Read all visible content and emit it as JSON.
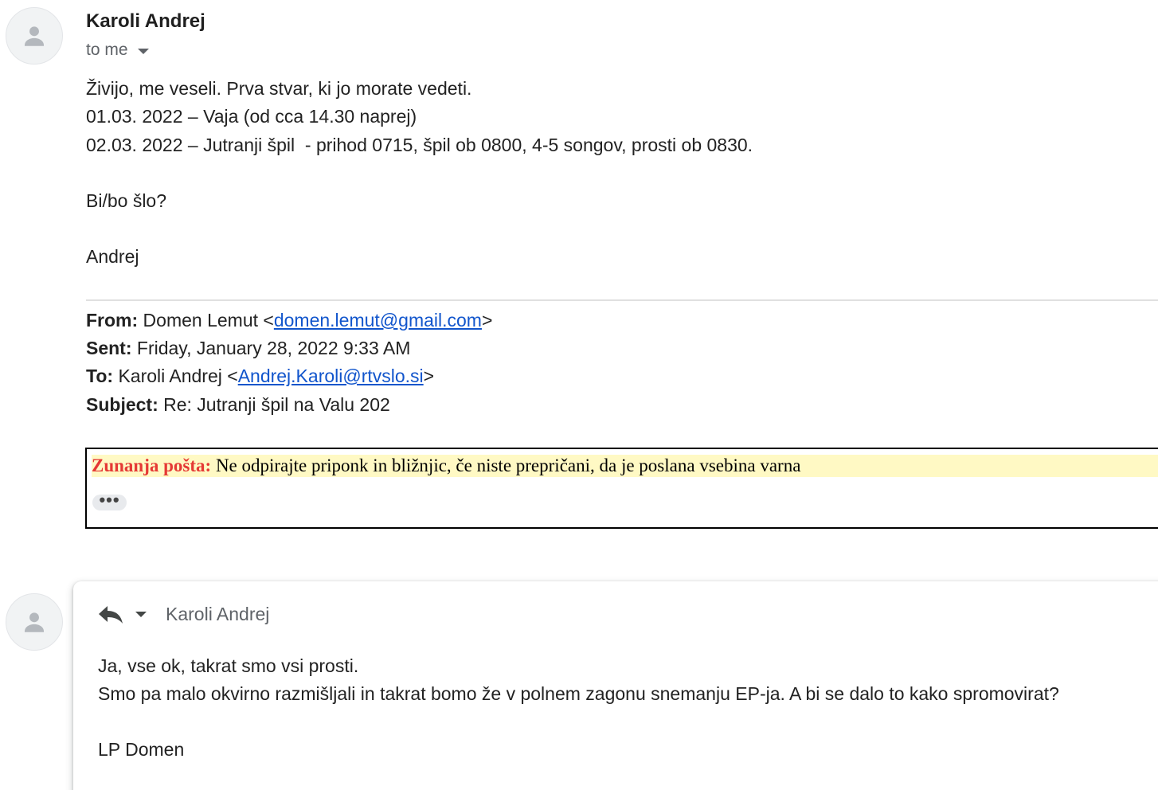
{
  "message": {
    "sender": "Karoli Andrej",
    "recipient_label": "to me",
    "body_lines": [
      "Živijo, me veseli. Prva stvar, ki jo morate vedeti.",
      "01.03. 2022 – Vaja (od cca 14.30 naprej)",
      "02.03. 2022 – Jutranji špil  - prihod 0715, špil ob 0800, 4-5 songov, prosti ob 0830.",
      "Bi/bo šlo?",
      "Andrej"
    ]
  },
  "quoted": {
    "from_label": "From:",
    "from_name": " Domen Lemut <",
    "from_email": "domen.lemut@gmail.com",
    "from_close": ">",
    "sent_label": "Sent:",
    "sent_value": " Friday, January 28, 2022 9:33 AM",
    "to_label": "To:",
    "to_name": " Karoli Andrej <",
    "to_email": "Andrej.Karoli@rtvslo.si",
    "to_close": ">",
    "subject_label": "Subject:",
    "subject_value": " Re: Jutranji špil na Valu 202"
  },
  "external_warning": {
    "label": "Zunanja pošta:",
    "text": " Ne odpirajte priponk in bližnjic, če niste prepričani, da je poslana vsebina varna",
    "label_color": "#e53935",
    "background": "#fff9c4"
  },
  "ellipsis": "•••",
  "reply": {
    "to_name": "Karoli Andrej",
    "body_lines": [
      "Ja, vse ok, takrat smo vsi prosti.",
      "Smo pa malo okvirno razmišljali in takrat bomo že v polnem zagonu snemanju EP-ja. A bi se dalo to kako spromovirat?",
      "LP Domen"
    ]
  },
  "icons": {
    "avatar": "person-icon",
    "reply": "reply-arrow-icon",
    "dropdown": "caret-down-icon"
  },
  "colors": {
    "link": "#1155cc",
    "muted_text": "#5f6368"
  }
}
